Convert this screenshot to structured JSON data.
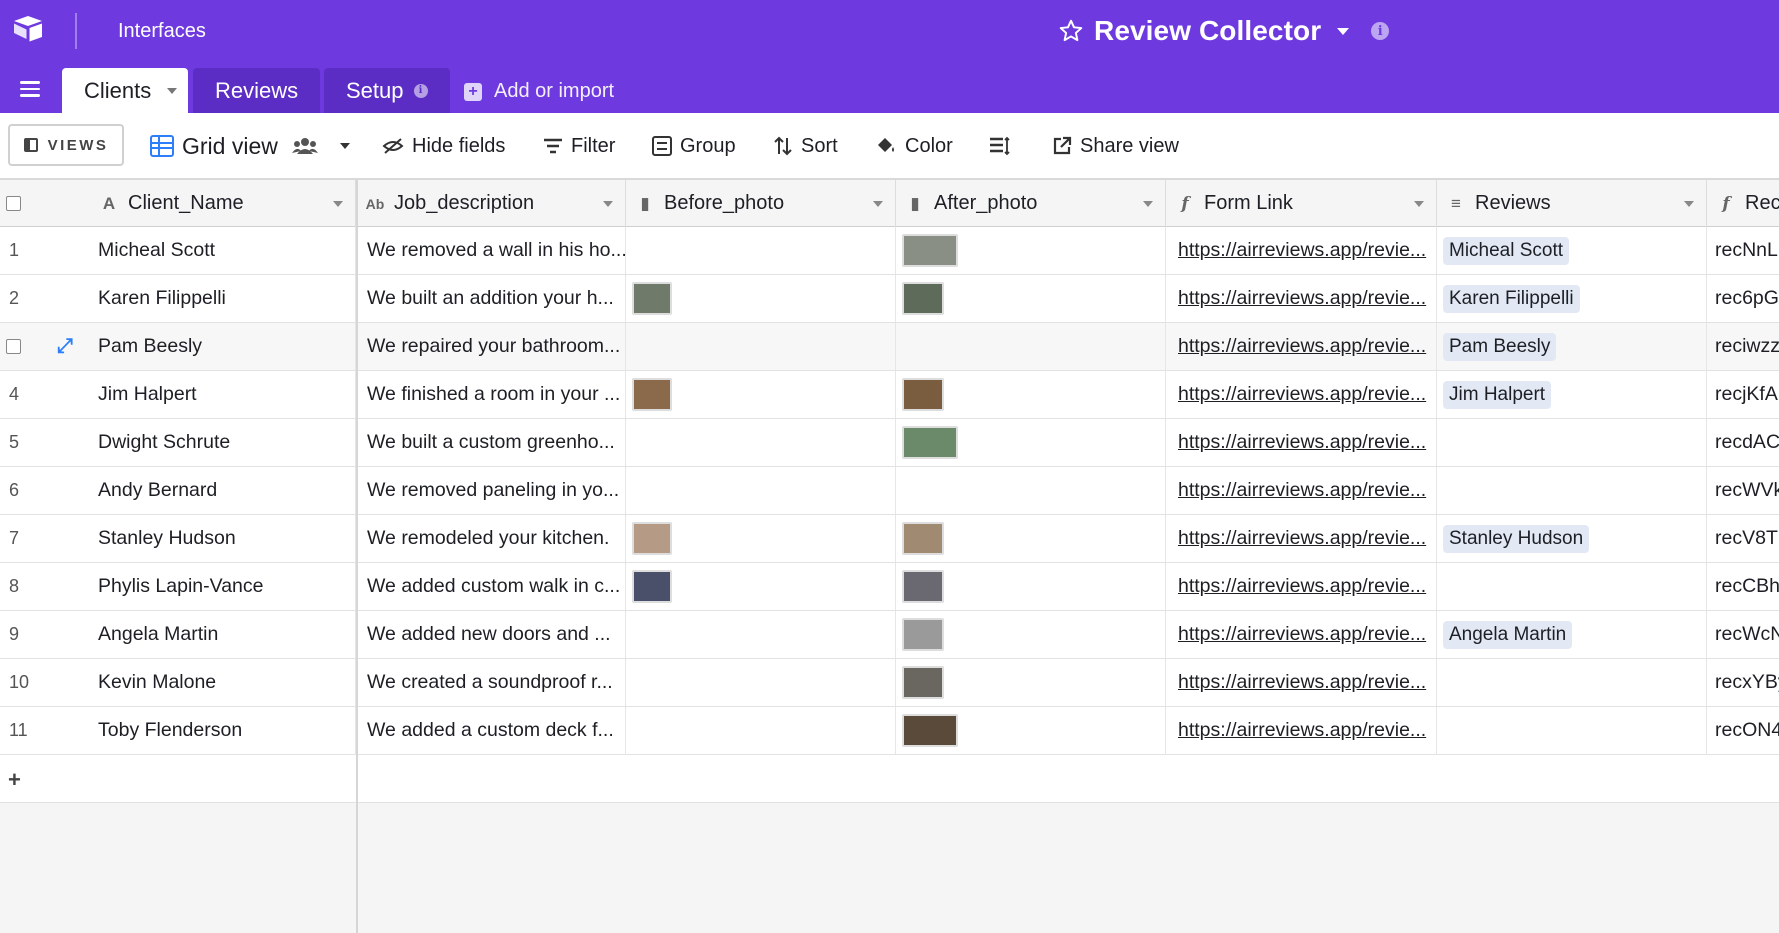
{
  "topbar": {
    "workspace_label": "Interfaces",
    "base_title": "Review Collector",
    "logo_icon": "airtable-logo-icon",
    "star_icon": "star-icon",
    "info_icon": "info-icon"
  },
  "tabs": [
    {
      "label": "Clients",
      "active": true
    },
    {
      "label": "Reviews",
      "active": false
    },
    {
      "label": "Setup",
      "active": false
    }
  ],
  "add_import_label": "Add or import",
  "toolbar": {
    "views_label": "VIEWS",
    "view_name": "Grid view",
    "hide_fields": "Hide fields",
    "filter": "Filter",
    "group": "Group",
    "sort": "Sort",
    "color": "Color",
    "share_view": "Share view"
  },
  "columns": [
    {
      "label": "Client_Name",
      "icon": "text-icon"
    },
    {
      "label": "Job_description",
      "icon": "long-text-icon"
    },
    {
      "label": "Before_photo",
      "icon": "attachment-icon"
    },
    {
      "label": "After_photo",
      "icon": "attachment-icon"
    },
    {
      "label": "Form Link",
      "icon": "formula-icon"
    },
    {
      "label": "Reviews",
      "icon": "linked-record-icon"
    },
    {
      "label": "Rec",
      "icon": "formula-icon"
    }
  ],
  "rows": [
    {
      "num": "1",
      "name": "Micheal Scott",
      "job": "We removed a wall in his ho...",
      "before": null,
      "after": "#8a8f86",
      "link": "https://airreviews.app/revie...",
      "review": "Micheal Scott",
      "rec": "recNnL"
    },
    {
      "num": "2",
      "name": "Karen Filippelli",
      "job": "We built an addition your h...",
      "before": "#6f7a6a",
      "after": "#5f6b5a",
      "link": "https://airreviews.app/revie...",
      "review": "Karen Filippelli",
      "rec": "rec6pG"
    },
    {
      "num": "",
      "name": "Pam Beesly",
      "job": "We repaired your bathroom...",
      "before": null,
      "after": null,
      "link": "https://airreviews.app/revie...",
      "review": "Pam Beesly",
      "rec": "reciwzz"
    },
    {
      "num": "4",
      "name": "Jim Halpert",
      "job": "We finished a room in your ...",
      "before": "#8a6a4a",
      "after": "#7a5c3e",
      "link": "https://airreviews.app/revie...",
      "review": "Jim Halpert",
      "rec": "recjKfA"
    },
    {
      "num": "5",
      "name": "Dwight Schrute",
      "job": "We built a custom greenho...",
      "before": null,
      "after": "#6b8a6a",
      "link": "https://airreviews.app/revie...",
      "review": "",
      "rec": "recdAC"
    },
    {
      "num": "6",
      "name": "Andy Bernard",
      "job": "We removed paneling in yo...",
      "before": null,
      "after": null,
      "link": "https://airreviews.app/revie...",
      "review": "",
      "rec": "recWVk"
    },
    {
      "num": "7",
      "name": "Stanley Hudson",
      "job": "We remodeled your kitchen.",
      "before": "#b59a86",
      "after": "#a08a72",
      "link": "https://airreviews.app/revie...",
      "review": "Stanley Hudson",
      "rec": "recV8T"
    },
    {
      "num": "8",
      "name": "Phylis Lapin-Vance",
      "job": "We added custom walk in c...",
      "before": "#4a4f6a",
      "after": "#6a6870",
      "link": "https://airreviews.app/revie...",
      "review": "",
      "rec": "recCBh"
    },
    {
      "num": "9",
      "name": "Angela Martin",
      "job": "We added new doors and ...",
      "before": null,
      "after": "#9a9a9a",
      "link": "https://airreviews.app/revie...",
      "review": "Angela Martin",
      "rec": "recWcN"
    },
    {
      "num": "10",
      "name": "Kevin Malone",
      "job": "We created a soundproof r...",
      "before": null,
      "after": "#6a6660",
      "link": "https://airreviews.app/revie...",
      "review": "",
      "rec": "recxYBy"
    },
    {
      "num": "11",
      "name": "Toby Flenderson",
      "job": "We added a custom deck f...",
      "before": null,
      "after": "#5a4a3a",
      "link": "https://airreviews.app/revie...",
      "review": "",
      "rec": "recON4"
    }
  ]
}
